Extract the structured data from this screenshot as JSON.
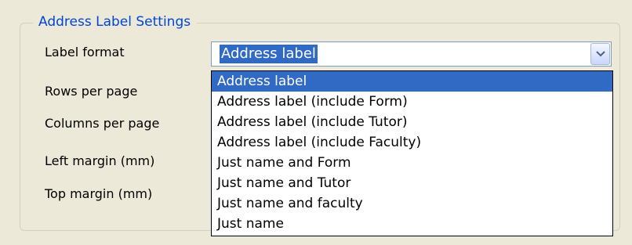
{
  "group": {
    "title": "Address Label Settings"
  },
  "fields": {
    "label_format": "Label format",
    "rows_per_page": "Rows per page",
    "columns_per_page": "Columns per page",
    "left_margin": "Left margin (mm)",
    "top_margin": "Top margin (mm)"
  },
  "combo": {
    "selected_value": "Address label",
    "button_icon": "chevron-down-icon"
  },
  "dropdown": {
    "options": [
      "Address label",
      "Address label (include Form)",
      "Address label (include Tutor)",
      "Address label (include Faculty)",
      "Just name and Form",
      "Just name and Tutor",
      "Just name and faculty",
      "Just name"
    ],
    "selected_index": 0
  },
  "colors": {
    "window_background": "#ece9d8",
    "group_title": "#0046d5",
    "selection_background": "#316ac5",
    "selection_text": "#ffffff"
  }
}
